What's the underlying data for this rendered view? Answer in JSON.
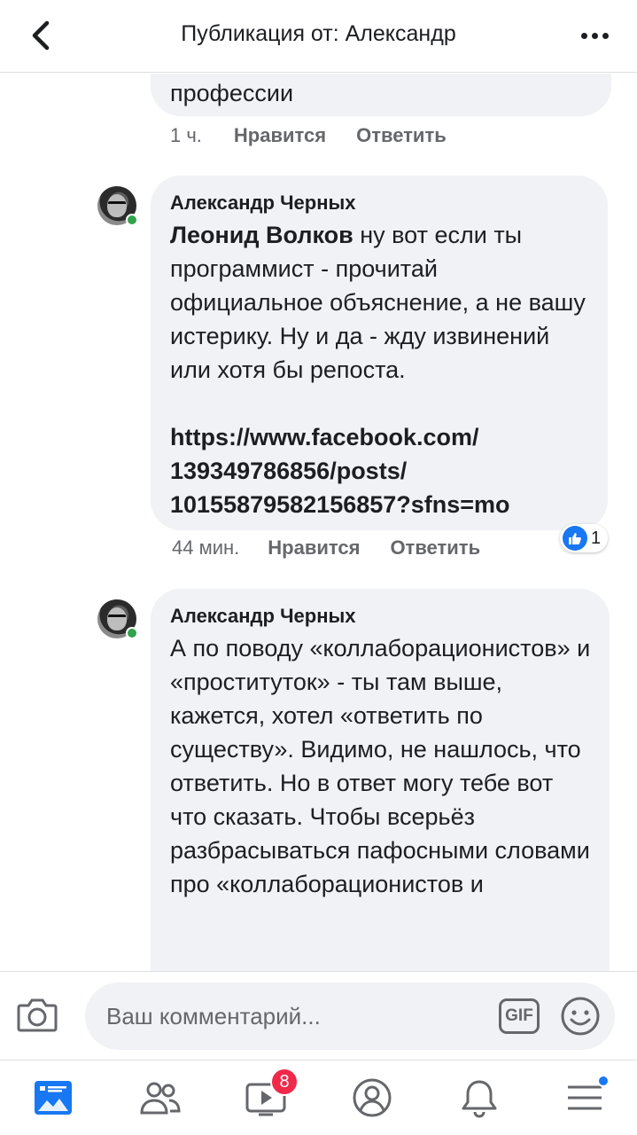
{
  "header": {
    "title": "Публикация от: Александр"
  },
  "comments": [
    {
      "tail_text": "профессии",
      "time": "1 ч.",
      "like_label": "Нравится",
      "reply_label": "Ответить"
    },
    {
      "author": "Александр Черных",
      "mention": "Леонид Волков",
      "text": " ну вот если ты программист - прочитай официальное объяснение, а не вашу истерику. Ну и да - жду извинений или хотя бы репоста.",
      "link_lines": [
        "https://www.facebook.com/",
        "139349786856/posts/",
        "10155879582156857?sfns=mo"
      ],
      "time": "44 мин.",
      "like_label": "Нравится",
      "reply_label": "Ответить",
      "reaction_count": "1"
    },
    {
      "author": "Александр Черных",
      "text": "А по поводу «коллаборационистов» и «проституток» - ты там выше, кажется, хотел «ответить по существу». Видимо, не нашлось, что ответить. Но в ответ могу тебе вот что сказать. Чтобы всерьёз разбрасываться пафосными словами про «коллаборационистов и"
    }
  ],
  "composer": {
    "placeholder": "Ваш комментарий...",
    "gif_label": "GIF"
  },
  "tabbar": {
    "video_badge": "8"
  },
  "colors": {
    "accent": "#1877f2",
    "online": "#31a24c",
    "badge": "#f02849",
    "bubble": "#f0f2f5",
    "secondary_text": "#65676b"
  }
}
